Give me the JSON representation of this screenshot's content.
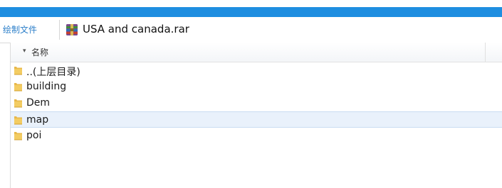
{
  "pathbar": {
    "prefix": "绘制文件",
    "archive_name": "USA and canada.rar"
  },
  "list": {
    "column_name": "名称",
    "sort_arrow": "▾",
    "rows": [
      {
        "label": "..(上层目录)",
        "selected": false
      },
      {
        "label": "building",
        "selected": false
      },
      {
        "label": "Dem",
        "selected": false
      },
      {
        "label": "map",
        "selected": true
      },
      {
        "label": "poi",
        "selected": false
      }
    ]
  },
  "colors": {
    "title_bar": "#1e8ee0",
    "selection": "#e9f1fb",
    "folder": "#e8b84a"
  },
  "icons": {
    "archive": "winrar-archive-icon",
    "folder": "folder-icon"
  }
}
